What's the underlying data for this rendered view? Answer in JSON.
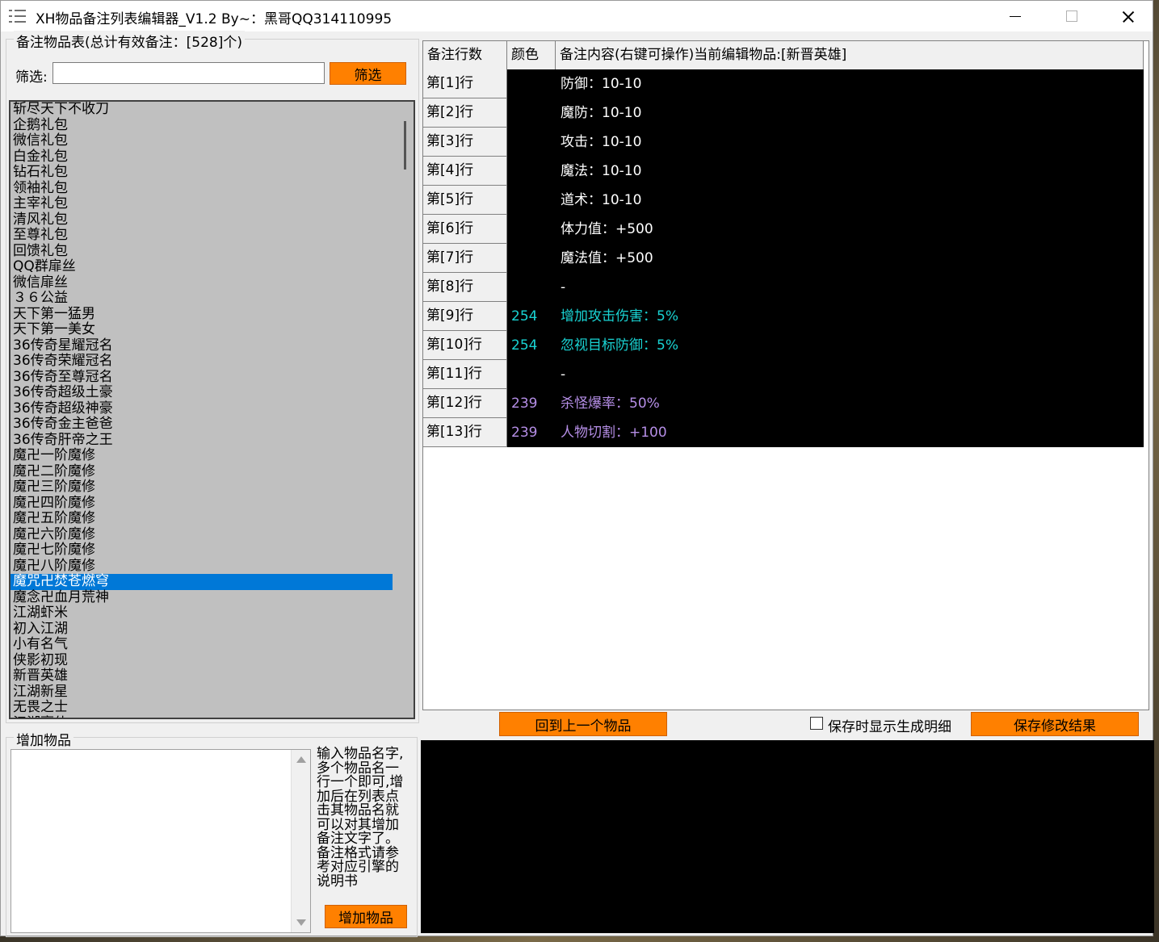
{
  "window": {
    "title": "XH物品备注列表编辑器_V1.2 By~：黑哥QQ314110995"
  },
  "left_panel": {
    "group_label": "备注物品表(总计有效备注：[528]个)",
    "filter_label": "筛选:",
    "filter_value": "",
    "filter_button": "筛选",
    "items": [
      "斩尽天下不收刀",
      "企鹅礼包",
      "微信礼包",
      "白金礼包",
      "钻石礼包",
      "领袖礼包",
      "主宰礼包",
      "清风礼包",
      "至尊礼包",
      "回馈礼包",
      "QQ群扉丝",
      "微信扉丝",
      "３６公益",
      "天下第一猛男",
      "天下第一美女",
      "36传奇星耀冠名",
      "36传奇荣耀冠名",
      "36传奇至尊冠名",
      "36传奇超级土豪",
      "36传奇超级神豪",
      "36传奇金主爸爸",
      "36传奇肝帝之王",
      "魔卍一阶魔修",
      "魔卍二阶魔修",
      "魔卍三阶魔修",
      "魔卍四阶魔修",
      "魔卍五阶魔修",
      "魔卍六阶魔修",
      "魔卍七阶魔修",
      "魔卍八阶魔修",
      "魔咒卍焚苍燃穹",
      "魔念卍血月荒神",
      "江湖虾米",
      "初入江湖",
      "小有名气",
      "侠影初现",
      "新晋英雄",
      "江湖新星",
      "无畏之士",
      "江湖豪侠"
    ],
    "selected_index": 30
  },
  "add_panel": {
    "group_label": "增加物品",
    "textarea_value": "",
    "help_text": "输入物品名字,多个物品名一行一个即可,增加后在列表点击其物品名就可以对其增加备注文字了。备注格式请参考对应引擎的说明书",
    "add_button": "增加物品"
  },
  "grid": {
    "headers": [
      "备注行数",
      "颜色",
      "备注内容(右键可操作)当前编辑物品:[新晋英雄]"
    ],
    "rows": [
      {
        "line": "第[1]行",
        "color": "",
        "content": "防御：10-10",
        "text_color": "#ffffff"
      },
      {
        "line": "第[2]行",
        "color": "",
        "content": "魔防：10-10",
        "text_color": "#ffffff"
      },
      {
        "line": "第[3]行",
        "color": "",
        "content": "攻击：10-10",
        "text_color": "#ffffff"
      },
      {
        "line": "第[4]行",
        "color": "",
        "content": "魔法：10-10",
        "text_color": "#ffffff"
      },
      {
        "line": "第[5]行",
        "color": "",
        "content": "道术：10-10",
        "text_color": "#ffffff"
      },
      {
        "line": "第[6]行",
        "color": "",
        "content": "体力值：+500",
        "text_color": "#ffffff"
      },
      {
        "line": "第[7]行",
        "color": "",
        "content": "魔法值：+500",
        "text_color": "#ffffff"
      },
      {
        "line": "第[8]行",
        "color": "",
        "content": "-",
        "text_color": "#ffffff"
      },
      {
        "line": "第[9]行",
        "color": "254",
        "content": "增加攻击伤害：5%",
        "text_color": "#19d3d3"
      },
      {
        "line": "第[10]行",
        "color": "254",
        "content": "忽视目标防御：5%",
        "text_color": "#19d3d3"
      },
      {
        "line": "第[11]行",
        "color": "",
        "content": "-",
        "text_color": "#ffffff"
      },
      {
        "line": "第[12]行",
        "color": "239",
        "content": "杀怪爆率：50%",
        "text_color": "#b58ee6"
      },
      {
        "line": "第[13]行",
        "color": "239",
        "content": "人物切割：+100",
        "text_color": "#b58ee6"
      }
    ]
  },
  "bottom_bar": {
    "back_button": "回到上一个物品",
    "checkbox_label": "保存时显示生成明细",
    "checkbox_checked": false,
    "save_button": "保存修改结果"
  },
  "colors": {
    "accent_orange": "#ff8000",
    "selection_blue": "#0078d7",
    "list_bg": "#c0c0c0"
  }
}
